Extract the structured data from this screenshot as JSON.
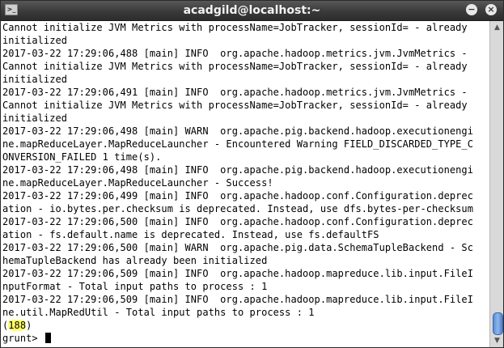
{
  "window": {
    "title": "acadgild@localhost:~",
    "icons": {
      "app": "terminal-icon",
      "minimize": "minimize-icon",
      "close": "close-icon"
    }
  },
  "terminal": {
    "lines": [
      "Cannot initialize JVM Metrics with processName=JobTracker, sessionId= - already",
      "initialized",
      "2017-03-22 17:29:06,488 [main] INFO  org.apache.hadoop.metrics.jvm.JvmMetrics -",
      "Cannot initialize JVM Metrics with processName=JobTracker, sessionId= - already",
      "initialized",
      "2017-03-22 17:29:06,491 [main] INFO  org.apache.hadoop.metrics.jvm.JvmMetrics -",
      "Cannot initialize JVM Metrics with processName=JobTracker, sessionId= - already",
      "initialized",
      "2017-03-22 17:29:06,498 [main] WARN  org.apache.pig.backend.hadoop.executionengi",
      "ne.mapReduceLayer.MapReduceLauncher - Encountered Warning FIELD_DISCARDED_TYPE_C",
      "ONVERSION_FAILED 1 time(s).",
      "2017-03-22 17:29:06,498 [main] INFO  org.apache.pig.backend.hadoop.executionengi",
      "ne.mapReduceLayer.MapReduceLauncher - Success!",
      "2017-03-22 17:29:06,499 [main] INFO  org.apache.hadoop.conf.Configuration.deprec",
      "ation - io.bytes.per.checksum is deprecated. Instead, use dfs.bytes-per-checksum",
      "2017-03-22 17:29:06,500 [main] INFO  org.apache.hadoop.conf.Configuration.deprec",
      "ation - fs.default.name is deprecated. Instead, use fs.defaultFS",
      "2017-03-22 17:29:06,500 [main] WARN  org.apache.pig.data.SchemaTupleBackend - Sc",
      "hemaTupleBackend has already been initialized",
      "2017-03-22 17:29:06,509 [main] INFO  org.apache.hadoop.mapreduce.lib.input.FileI",
      "nputFormat - Total input paths to process : 1",
      "2017-03-22 17:29:06,509 [main] INFO  org.apache.hadoop.mapreduce.lib.input.FileI",
      "ne.util.MapRedUtil - Total input paths to process : 1"
    ],
    "result_open": "(",
    "result_value": "188",
    "result_close": ")",
    "prompt": "grunt> "
  }
}
